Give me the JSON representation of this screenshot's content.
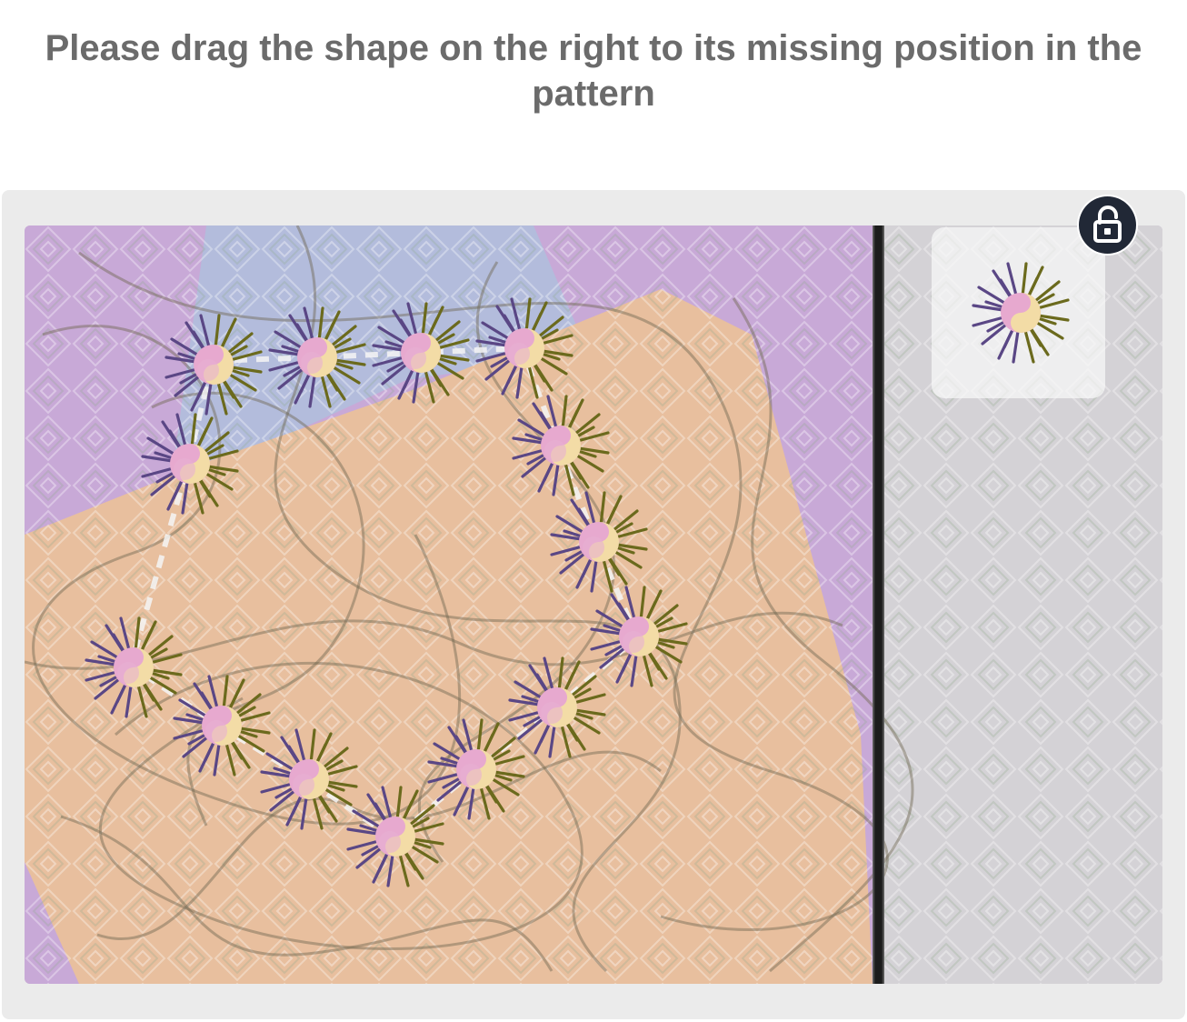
{
  "instruction": {
    "text": "Please drag the shape on the right to its missing position in the pattern"
  },
  "colors": {
    "panel_background": "#ebebeb",
    "divider": "#1c1c1c",
    "lock_button": "#212836",
    "petal_purple": "#5f4b8c",
    "petal_olive": "#6a6a1e",
    "center_pink": "#e4a6cd",
    "center_cream": "#f2d9a4",
    "region_purple": "#c7a7d7",
    "region_orange": "#e9bd9c",
    "region_blue": "#b4bcd9"
  },
  "icons": {
    "lock": "unlocked-padlock-icon",
    "piece": "flower-star-icon"
  },
  "pattern": {
    "shape": "heart",
    "placed_piece_count": 15,
    "missing_piece_count": 1
  }
}
